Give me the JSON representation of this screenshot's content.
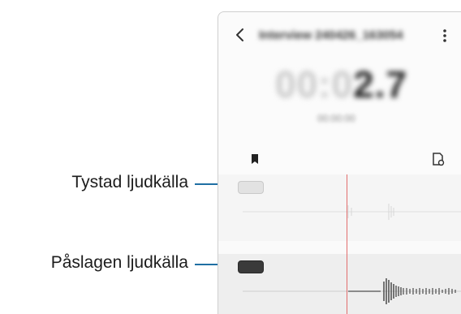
{
  "callouts": {
    "muted_label": "Tystad ljudkälla",
    "active_label": "Påslagen ljudkälla",
    "leader_color": "#1f6fa3"
  },
  "app": {
    "title": "Interview 240426_163054",
    "timer_prefix": "00:0",
    "timer_main": "2.7",
    "timer_sub": "00:00:00",
    "back_icon": "chevron-left-icon",
    "more_icon": "more-vertical-icon",
    "bookmark_icon": "bookmark-icon",
    "note_icon": "note-icon"
  },
  "tracks": [
    {
      "name": "muted",
      "state": "off",
      "toggle_color": "#e2e2e2"
    },
    {
      "name": "active",
      "state": "on",
      "toggle_color": "#3a3a3a"
    }
  ],
  "playhead_color": "#e26d6d"
}
